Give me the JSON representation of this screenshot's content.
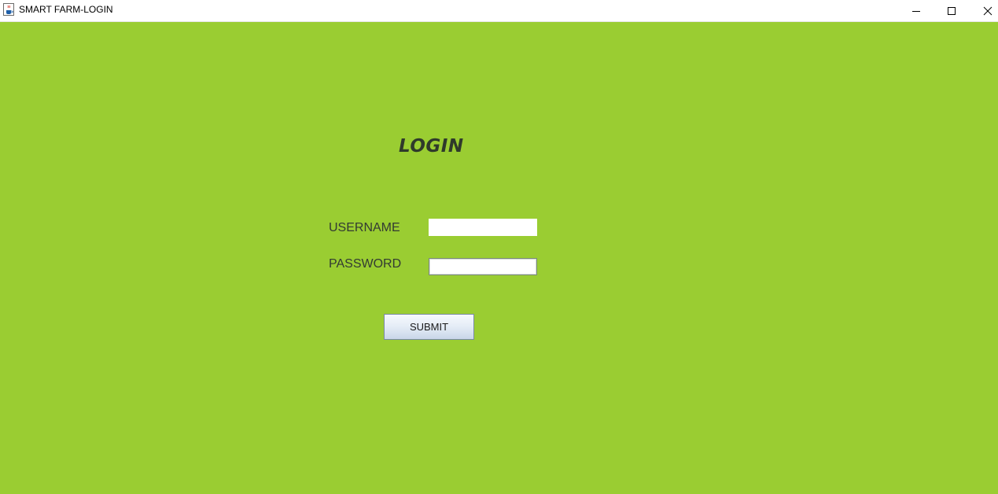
{
  "window": {
    "title": "SMART FARM-LOGIN",
    "app_icon": "java-coffee-cup-icon",
    "controls": {
      "minimize_icon": "minimize-icon",
      "maximize_icon": "maximize-icon",
      "close_icon": "close-icon"
    }
  },
  "colors": {
    "background": "#9acd32",
    "title_text": "#2f3a2b",
    "label_text": "#333a33"
  },
  "login": {
    "heading": "LOGIN",
    "username_label": "USERNAME",
    "username_value": "",
    "password_label": "PASSWORD",
    "password_value": "",
    "submit_label": "SUBMIT"
  }
}
